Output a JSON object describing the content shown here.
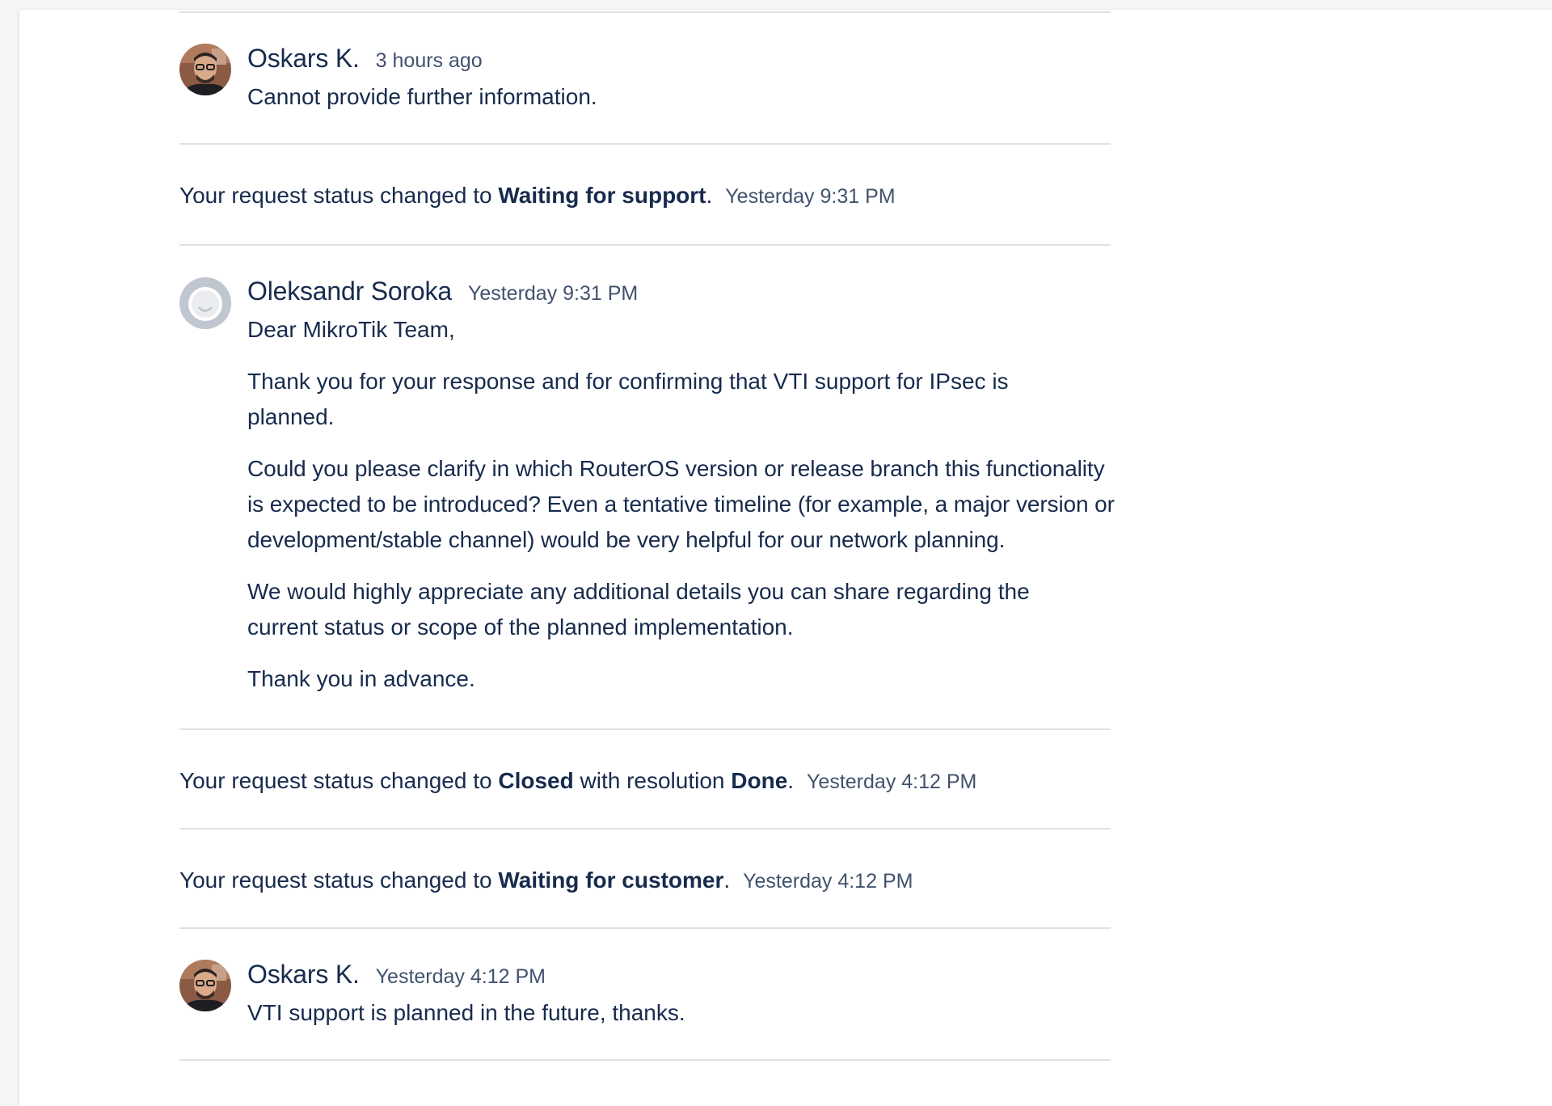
{
  "feed": {
    "comment1": {
      "author": "Oskars K.",
      "time": "3 hours ago",
      "text": "Cannot provide further information."
    },
    "status1": {
      "prefix": "Your request status changed to ",
      "status": "Waiting for support",
      "suffix": ".",
      "time": "Yesterday 9:31 PM"
    },
    "comment2": {
      "author": "Oleksandr Soroka",
      "time": "Yesterday 9:31 PM",
      "paragraphs": [
        "Dear MikroTik Team,",
        "Thank you for your response and for confirming that VTI support for IPsec is planned.",
        "Could you please clarify in which RouterOS version or release branch this functionality is expected to be introduced? Even a tentative timeline (for example, a major version or development/stable channel) would be very helpful for our network planning.",
        "We would highly appreciate any additional details you can share regarding the current status or scope of the planned implementation.",
        "Thank you in advance."
      ]
    },
    "status2": {
      "prefix": "Your request status changed to ",
      "status": "Closed",
      "middle": " with resolution ",
      "resolution": "Done",
      "suffix": ".",
      "time": "Yesterday 4:12 PM"
    },
    "status3": {
      "prefix": "Your request status changed to ",
      "status": "Waiting for customer",
      "suffix": ".",
      "time": "Yesterday 4:12 PM"
    },
    "comment3": {
      "author": "Oskars K.",
      "time": "Yesterday 4:12 PM",
      "text": "VTI support is planned in the future, thanks."
    }
  },
  "colors": {
    "text": "#172b4d",
    "muted": "#42526e",
    "divider": "#dfe1e6",
    "background": "#f4f5f7"
  },
  "icons": {
    "avatar_photo": "user-photo-avatar",
    "avatar_default": "default-user-avatar"
  }
}
